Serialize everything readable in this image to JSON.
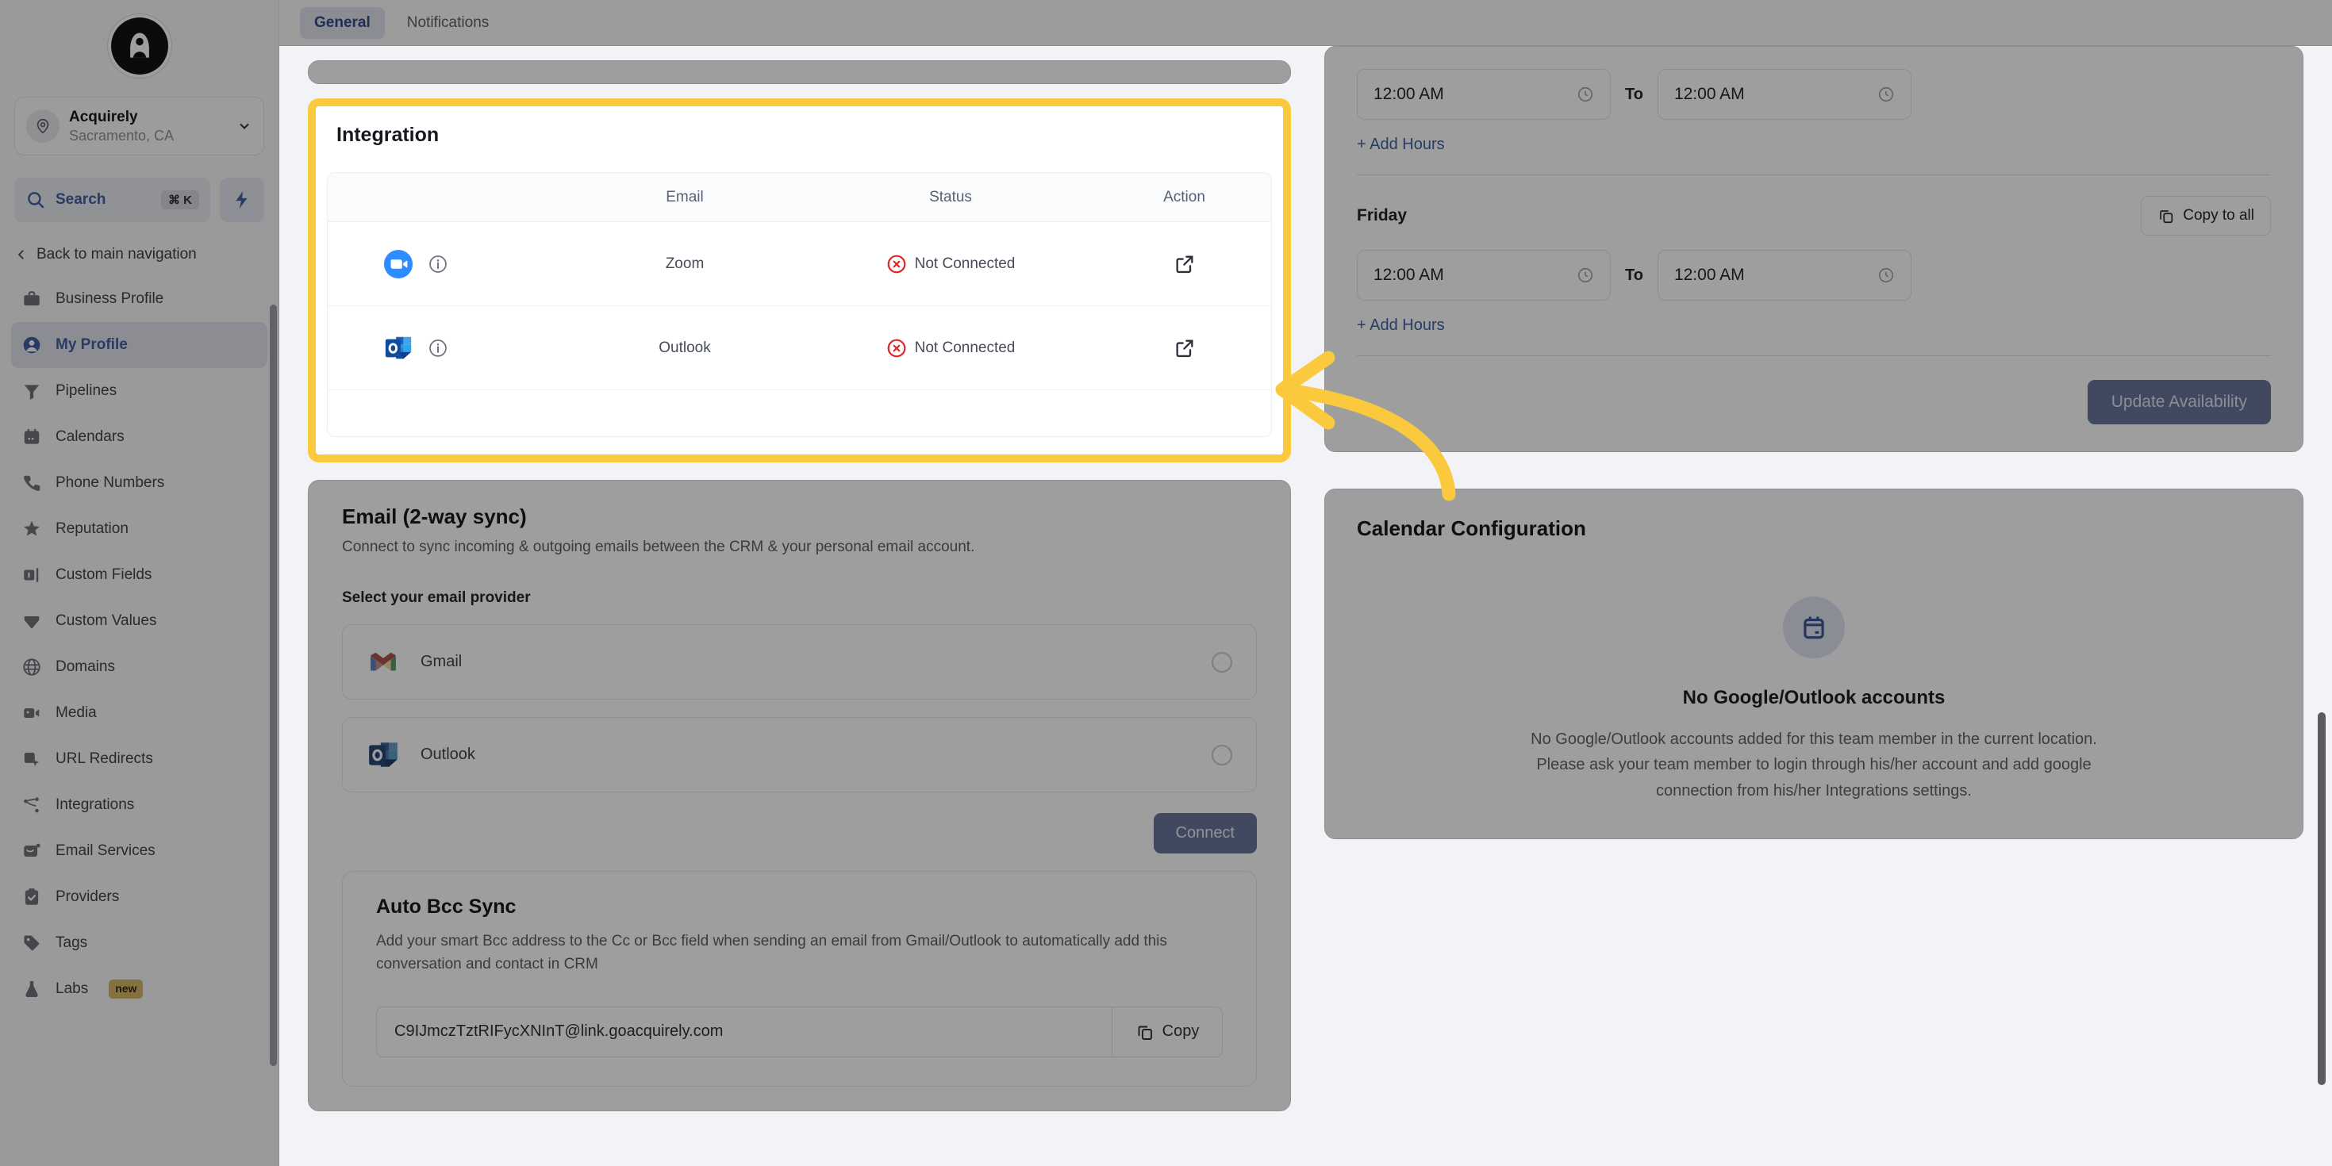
{
  "sidebar": {
    "logo_alt": "acquirely-logo",
    "location": {
      "name": "Acquirely",
      "sub": "Sacramento, CA"
    },
    "search": {
      "label": "Search",
      "shortcut": "⌘ K"
    },
    "back_label": "Back to main navigation",
    "items": [
      {
        "label": "Business Profile",
        "icon": "briefcase-icon",
        "active": false
      },
      {
        "label": "My Profile",
        "icon": "user-circle-icon",
        "active": true
      },
      {
        "label": "Pipelines",
        "icon": "funnel-icon",
        "active": false
      },
      {
        "label": "Calendars",
        "icon": "calendar-icon",
        "active": false
      },
      {
        "label": "Phone Numbers",
        "icon": "phone-icon",
        "active": false
      },
      {
        "label": "Reputation",
        "icon": "star-icon",
        "active": false
      },
      {
        "label": "Custom Fields",
        "icon": "custom-fields-icon",
        "active": false
      },
      {
        "label": "Custom Values",
        "icon": "diamond-icon",
        "active": false
      },
      {
        "label": "Domains",
        "icon": "globe-icon",
        "active": false
      },
      {
        "label": "Media",
        "icon": "video-icon",
        "active": false
      },
      {
        "label": "URL Redirects",
        "icon": "cursor-square-icon",
        "active": false
      },
      {
        "label": "Integrations",
        "icon": "share-nodes-icon",
        "active": false
      },
      {
        "label": "Email Services",
        "icon": "envelope-icon",
        "active": false
      },
      {
        "label": "Providers",
        "icon": "clipboard-check-icon",
        "active": false
      },
      {
        "label": "Tags",
        "icon": "tag-icon",
        "active": false
      },
      {
        "label": "Labs",
        "icon": "flask-icon",
        "active": false,
        "badge": "new"
      }
    ]
  },
  "tabs": [
    {
      "label": "General",
      "active": true
    },
    {
      "label": "Notifications",
      "active": false
    }
  ],
  "integration": {
    "title": "Integration",
    "columns": {
      "icon": "",
      "email": "Email",
      "status": "Status",
      "action": "Action"
    },
    "rows": [
      {
        "icon": "zoom-icon",
        "name": "Zoom",
        "status": "Not Connected",
        "status_icon": "circle-x-icon",
        "action_icon": "external-link-icon",
        "info_icon": "info-icon"
      },
      {
        "icon": "outlook-icon",
        "name": "Outlook",
        "status": "Not Connected",
        "status_icon": "circle-x-icon",
        "action_icon": "external-link-icon",
        "info_icon": "info-icon"
      }
    ]
  },
  "email_sync": {
    "title": "Email (2-way sync)",
    "subtitle": "Connect to sync incoming & outgoing emails between the CRM & your personal email account.",
    "select_label": "Select your email provider",
    "providers": [
      {
        "label": "Gmail",
        "icon": "gmail-icon",
        "selected": false
      },
      {
        "label": "Outlook",
        "icon": "outlook-icon",
        "selected": false
      }
    ],
    "connect_label": "Connect"
  },
  "auto_bcc": {
    "title": "Auto Bcc Sync",
    "description": "Add your smart Bcc address to the Cc or Bcc field when sending an email from Gmail/Outlook to automatically add this conversation and contact in CRM",
    "address": "C9IJmczTztRIFycXNInT@link.goacquirely.com",
    "copy_label": "Copy"
  },
  "availability": {
    "rows": [
      {
        "from": "12:00 AM",
        "to": "12:00 AM",
        "to_label": "To",
        "add_hours": "+ Add Hours"
      }
    ],
    "day": {
      "name": "Friday",
      "copy_to_all": "Copy to all",
      "from": "12:00 AM",
      "to": "12:00 AM",
      "to_label": "To",
      "add_hours": "+ Add Hours"
    },
    "update_label": "Update Availability"
  },
  "calendar_config": {
    "title": "Calendar Configuration",
    "empty_icon": "calendar-plug-icon",
    "empty_title": "No Google/Outlook accounts",
    "empty_text": "No Google/Outlook accounts added for this team member in the current location. Please ask your team member to login through his/her account and add google connection from his/her Integrations settings."
  },
  "annotation": {
    "arrow": "curved-arrow-left",
    "color": "#FBC93D"
  },
  "colors": {
    "accent": "#2563d9",
    "highlight": "#FBC93D",
    "danger": "#e02424",
    "button": "#5c76b9"
  }
}
